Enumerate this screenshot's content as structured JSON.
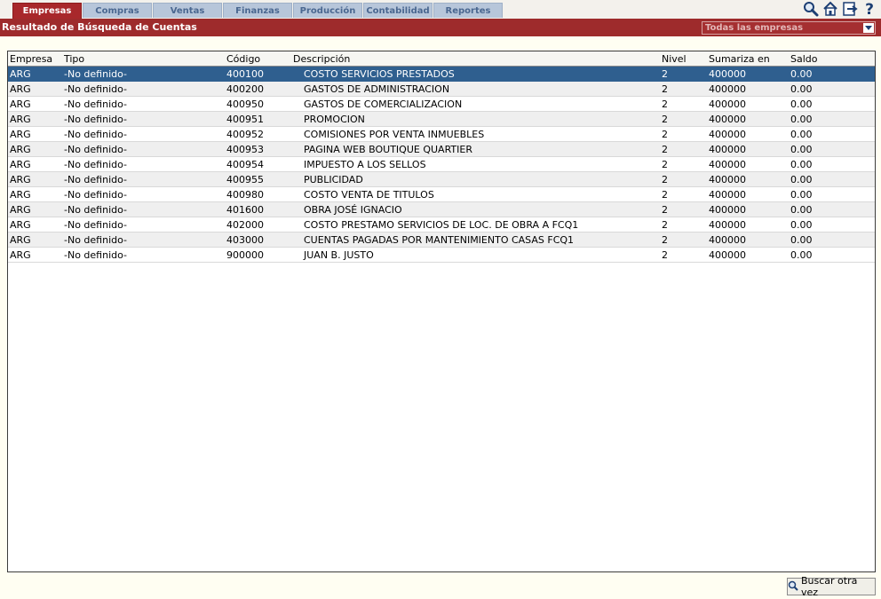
{
  "tabs": [
    {
      "label": "Empresas",
      "active": true
    },
    {
      "label": "Compras",
      "active": false
    },
    {
      "label": "Ventas",
      "active": false
    },
    {
      "label": "Finanzas",
      "active": false
    },
    {
      "label": "Producción",
      "active": false
    },
    {
      "label": "Contabilidad",
      "active": false
    },
    {
      "label": "Reportes",
      "active": false
    }
  ],
  "toolbar_icons": [
    "search-icon",
    "home-icon",
    "exit-icon",
    "help-icon"
  ],
  "header": {
    "title": "Resultado de Búsqueda de Cuentas",
    "company_select": "Todas las empresas"
  },
  "table": {
    "columns": [
      "Empresa",
      "Tipo",
      "Código",
      "Descripción",
      "Nivel",
      "Sumariza en",
      "Saldo"
    ],
    "selected_row": 0,
    "rows": [
      [
        "ARG",
        "-No definido-",
        "400100",
        "COSTO SERVICIOS PRESTADOS",
        "2",
        "400000",
        "0.00"
      ],
      [
        "ARG",
        "-No definido-",
        "400200",
        "GASTOS DE ADMINISTRACION",
        "2",
        "400000",
        "0.00"
      ],
      [
        "ARG",
        "-No definido-",
        "400950",
        "GASTOS DE COMERCIALIZACION",
        "2",
        "400000",
        "0.00"
      ],
      [
        "ARG",
        "-No definido-",
        "400951",
        "PROMOCION",
        "2",
        "400000",
        "0.00"
      ],
      [
        "ARG",
        "-No definido-",
        "400952",
        "COMISIONES POR VENTA INMUEBLES",
        "2",
        "400000",
        "0.00"
      ],
      [
        "ARG",
        "-No definido-",
        "400953",
        "PAGINA WEB BOUTIQUE QUARTIER",
        "2",
        "400000",
        "0.00"
      ],
      [
        "ARG",
        "-No definido-",
        "400954",
        "IMPUESTO A LOS SELLOS",
        "2",
        "400000",
        "0.00"
      ],
      [
        "ARG",
        "-No definido-",
        "400955",
        "PUBLICIDAD",
        "2",
        "400000",
        "0.00"
      ],
      [
        "ARG",
        "-No definido-",
        "400980",
        "COSTO VENTA DE TITULOS",
        "2",
        "400000",
        "0.00"
      ],
      [
        "ARG",
        "-No definido-",
        "401600",
        "OBRA JOSÉ IGNACIO",
        "2",
        "400000",
        "0.00"
      ],
      [
        "ARG",
        "-No definido-",
        "402000",
        "COSTO PRESTAMO SERVICIOS DE LOC. DE OBRA A FCQ1",
        "2",
        "400000",
        "0.00"
      ],
      [
        "ARG",
        "-No definido-",
        "403000",
        "CUENTAS PAGADAS POR MANTENIMIENTO CASAS FCQ1",
        "2",
        "400000",
        "0.00"
      ],
      [
        "ARG",
        "-No definido-",
        "900000",
        "JUAN B. JUSTO",
        "2",
        "400000",
        "0.00"
      ]
    ]
  },
  "footer": {
    "search_again_label": "Buscar otra vez"
  }
}
